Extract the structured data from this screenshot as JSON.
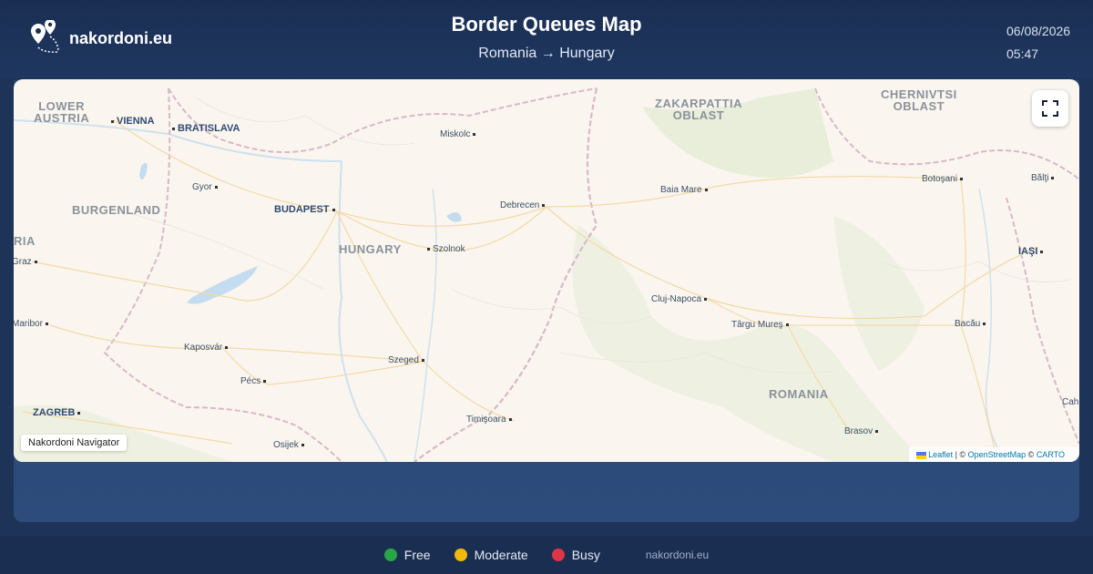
{
  "header": {
    "brand": "nakordoni.eu",
    "title": "Border Queues Map",
    "route": "Romania → Hungary",
    "date": "06/08/2026",
    "time": "05:47"
  },
  "map": {
    "navigator_label": "Nakordoni Navigator",
    "attribution": {
      "leaflet": "Leaflet",
      "sep1": " | © ",
      "osm": "OpenStreetMap",
      "sep2": " © ",
      "carto": "CARTO"
    },
    "regions": {
      "lower_austria": "LOWER\nAUSTRIA",
      "burgenland": "BURGENLAND",
      "hungary": "HUNGARY",
      "zakarpattia": "ZAKARPATTIA\nOBLAST",
      "chernivtsi": "CHERNIVTSI\nOBLAST",
      "romania": "ROMANIA",
      "ria": "RIA"
    },
    "cities": {
      "vienna": "VIENNA",
      "bratislava": "BRATISLAVA",
      "miskolc": "Miskolc",
      "gyor": "Gyor",
      "budapest": "BUDAPEST",
      "debrecen": "Debrecen",
      "baia_mare": "Baia Mare",
      "botosani": "Botoşani",
      "balti": "Bălţi",
      "szolnok": "Szolnok",
      "graz": "Graz",
      "iasi": "IAŞI",
      "cluj": "Cluj-Napoca",
      "targu_mures": "Târgu Mureş",
      "maribor": "Maribor",
      "bacau": "Bacău",
      "kaposvar": "Kaposvár",
      "szeged": "Szeged",
      "pecs": "Pécs",
      "zagreb": "ZAGREB",
      "timisoara": "Timişoara",
      "osijek": "Osijek",
      "brasov": "Brasov",
      "cah": "Cah"
    }
  },
  "legend": [
    {
      "label": "Free",
      "color": "#28a745"
    },
    {
      "label": "Moderate",
      "color": "#f0b90b"
    },
    {
      "label": "Busy",
      "color": "#dc3545"
    }
  ],
  "footer": {
    "site": "nakordoni.eu"
  },
  "icons": {
    "brand": "map-pins-icon",
    "fullscreen": "fullscreen-icon"
  }
}
